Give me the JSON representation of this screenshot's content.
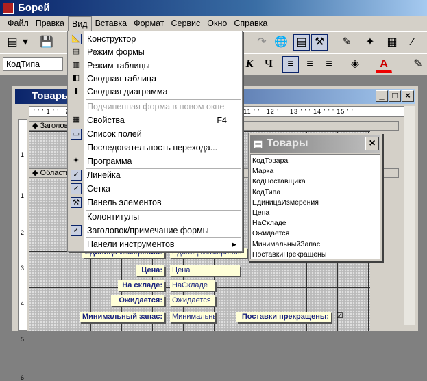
{
  "app": {
    "title": "Борей"
  },
  "menu": [
    "Файл",
    "Правка",
    "Вид",
    "Вставка",
    "Формат",
    "Сервис",
    "Окно",
    "Справка"
  ],
  "toolbar": {
    "field_combo": "КодТипа",
    "italic": "К",
    "underline": "Ч"
  },
  "form_window": {
    "title": "Товары",
    "ruler": "' ' ' 1 ' ' ' 2 ' ' ' 3 ' ' ' 4 ' ' ' 5 ' ' ' 6 ' ' ' 7 ' ' ' 8 ' ' ' 9 ' ' ' 10 ' ' ' 11 ' ' ' 12 ' ' ' 13 ' ' ' 14 ' ' ' 15 ' '",
    "header_band": "Заголовок формы",
    "detail_band": "Область данных",
    "vruler": [
      "1",
      "1",
      "2",
      "3",
      "4",
      "5",
      "6"
    ]
  },
  "form_controls": [
    {
      "label": "Единица измерения:",
      "field": "ЕдиницаИзмерения"
    },
    {
      "label": "Цена:",
      "field": "Цена"
    },
    {
      "label": "На складе:",
      "field": "НаСкладе"
    },
    {
      "label": "Ожидается:",
      "field": "Ожидается"
    },
    {
      "label": "Минимальный запас:",
      "field": "Минимальный"
    },
    {
      "label": "Поставки прекращены:",
      "field": "☑"
    }
  ],
  "view_menu": [
    {
      "label": "Конструктор",
      "icon": "design-icon"
    },
    {
      "label": "Режим формы",
      "icon": "form-icon"
    },
    {
      "label": "Режим таблицы",
      "icon": "table-icon"
    },
    {
      "label": "Сводная таблица",
      "icon": "pivot-table-icon"
    },
    {
      "label": "Сводная диаграмма",
      "icon": "pivot-chart-icon"
    },
    {
      "label": "Подчиненная форма в новом окне",
      "disabled": true
    },
    {
      "label": "Свойства",
      "shortcut": "F4",
      "icon": "properties-icon"
    },
    {
      "label": "Список полей",
      "icon": "field-list-icon"
    },
    {
      "label": "Последовательность перехода..."
    },
    {
      "label": "Программа",
      "icon": "code-icon"
    },
    {
      "label": "Линейка",
      "checked": true
    },
    {
      "label": "Сетка",
      "checked": true
    },
    {
      "label": "Панель элементов",
      "icon": "toolbox-icon"
    },
    {
      "label": "Колонтитулы"
    },
    {
      "label": "Заголовок/примечание формы",
      "checked": true
    },
    {
      "label": "Панели инструментов",
      "submenu": true
    }
  ],
  "field_list": {
    "title": "Товары",
    "fields": [
      "КодТовара",
      "Марка",
      "КодПоставщика",
      "КодТипа",
      "ЕдиницаИзмерения",
      "Цена",
      "НаСкладе",
      "Ожидается",
      "МинимальныйЗапас",
      "ПоставкиПрекращены"
    ]
  }
}
